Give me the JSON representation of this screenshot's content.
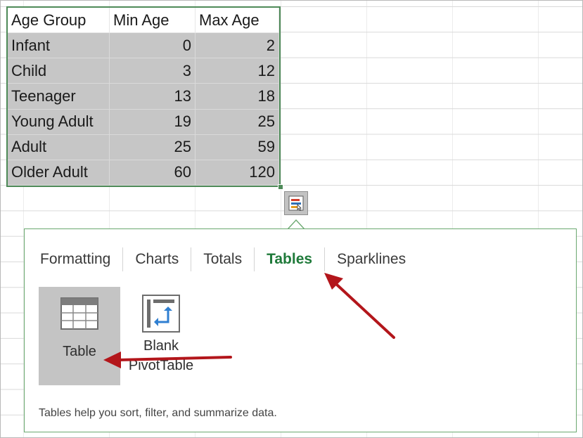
{
  "sheet": {
    "header": [
      "Age Group",
      "Min Age",
      "Max Age"
    ],
    "rows": [
      [
        "Infant",
        "0",
        "2"
      ],
      [
        "Child",
        "3",
        "12"
      ],
      [
        "Teenager",
        "13",
        "18"
      ],
      [
        "Young Adult",
        "19",
        "25"
      ],
      [
        "Adult",
        "25",
        "59"
      ],
      [
        "Older Adult",
        "60",
        "120"
      ]
    ]
  },
  "quick_analysis": {
    "button_icon": "quick-analysis-icon",
    "tabs": [
      {
        "label": "Formatting"
      },
      {
        "label": "Charts"
      },
      {
        "label": "Totals"
      },
      {
        "label": "Tables",
        "active": true
      },
      {
        "label": "Sparklines"
      }
    ],
    "options": [
      {
        "label": "Table",
        "icon": "table-icon",
        "selected": true
      },
      {
        "label": "Blank PivotTable",
        "icon": "pivot-table-icon"
      }
    ],
    "description": "Tables help you sort, filter, and summarize data."
  },
  "colors": {
    "selection_border": "#4e8a58",
    "active_tab": "#1f7a3a",
    "annotation_arrow": "#b3161b"
  }
}
